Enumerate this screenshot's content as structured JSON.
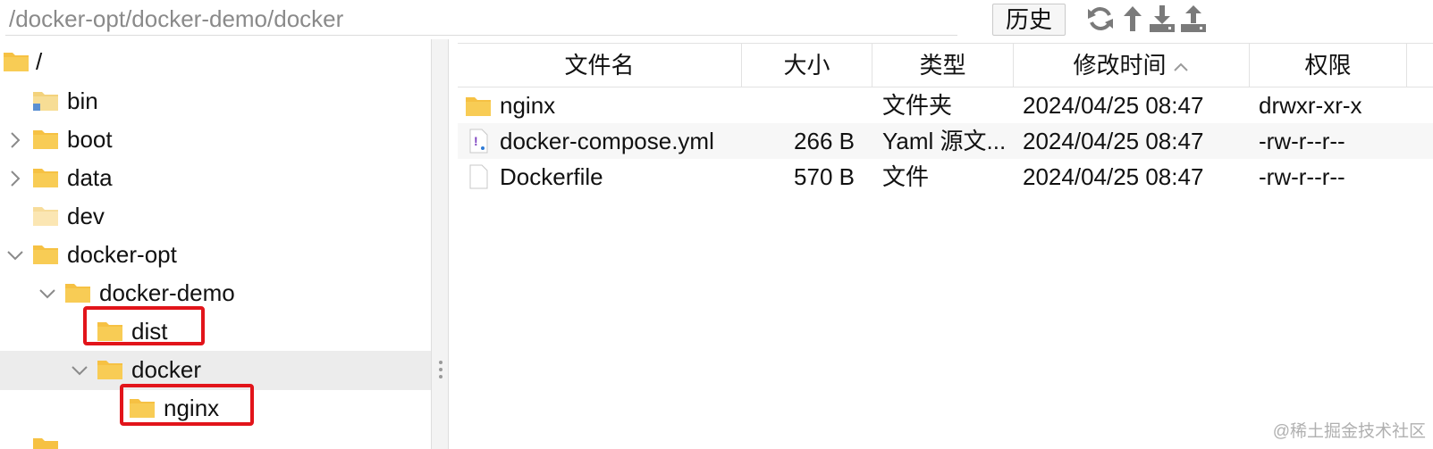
{
  "path_bar": {
    "value": "/docker-opt/docker-demo/docker",
    "history_label": "历史"
  },
  "toolbar_icons": [
    "refresh-icon",
    "up-arrow-icon",
    "download-icon",
    "upload-icon"
  ],
  "tree": [
    {
      "label": "/",
      "chevron": "none",
      "folder": "folder"
    },
    {
      "label": "bin",
      "chevron": "none",
      "folder": "link-folder"
    },
    {
      "label": "boot",
      "chevron": "right",
      "folder": "folder"
    },
    {
      "label": "data",
      "chevron": "right",
      "folder": "folder"
    },
    {
      "label": "dev",
      "chevron": "none",
      "folder": "light-folder"
    },
    {
      "label": "docker-opt",
      "chevron": "down",
      "folder": "folder"
    },
    {
      "label": "docker-demo",
      "chevron": "down",
      "folder": "folder"
    },
    {
      "label": "dist",
      "chevron": "none",
      "folder": "folder"
    },
    {
      "label": "docker",
      "chevron": "down",
      "folder": "folder",
      "selected": true
    },
    {
      "label": "nginx",
      "chevron": "none",
      "folder": "folder"
    }
  ],
  "list": {
    "columns": [
      "文件名",
      "大小",
      "类型",
      "修改时间",
      "权限"
    ],
    "sorted_column": "修改时间",
    "rows": [
      {
        "name": "nginx",
        "size": "",
        "type": "文件夹",
        "modified": "2024/04/25 08:47",
        "perm": "drwxr-xr-x",
        "icon": "folder-icon"
      },
      {
        "name": "docker-compose.yml",
        "size": "266 B",
        "type": "Yaml 源文...",
        "modified": "2024/04/25 08:47",
        "perm": "-rw-r--r--",
        "icon": "yaml-file-icon"
      },
      {
        "name": "Dockerfile",
        "size": "570 B",
        "type": "文件",
        "modified": "2024/04/25 08:47",
        "perm": "-rw-r--r--",
        "icon": "file-icon"
      }
    ]
  },
  "watermark": "@稀土掘金技术社区",
  "colors": {
    "folder": "#f6c143",
    "folder_light": "#fbe6a8",
    "highlight": "#e2141a",
    "selected_row": "#ececec"
  }
}
